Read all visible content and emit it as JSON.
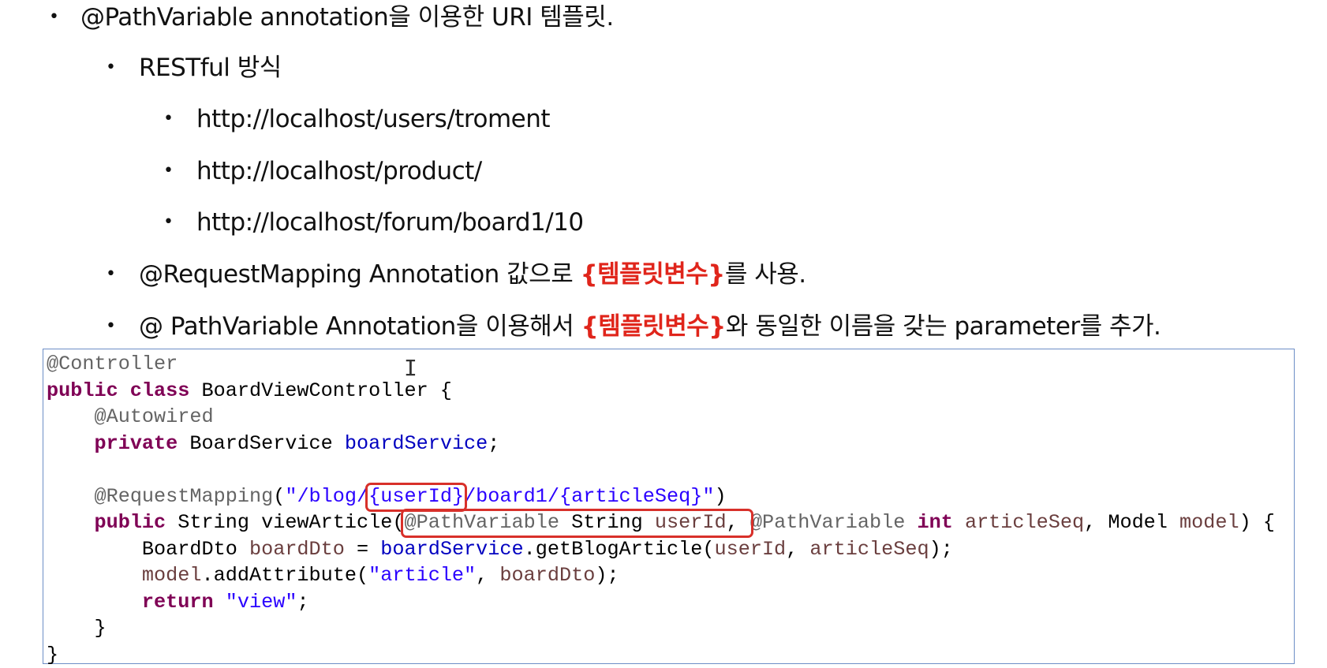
{
  "bullets": {
    "b1": "@PathVariable annotation을 이용한 URI 템플릿.",
    "b2": "RESTful 방식",
    "b3": "http://localhost/users/troment",
    "b4": "http://localhost/product/",
    "b5": "http://localhost/forum/board1/10",
    "b6_pre": "@RequestMapping Annotation 값으로 ",
    "b6_red": "{템플릿변수}",
    "b6_post": "를 사용.",
    "b7_pre": "@ PathVariable Annotation을 이용해서 ",
    "b7_red": "{템플릿변수}",
    "b7_post": "와 동일한 이름을 갖는 parameter를 추가."
  },
  "code": {
    "l1": "@Controller",
    "l2_kw": "public class",
    "l2": " BoardViewController {",
    "l3": "@Autowired",
    "l4_kw": "private",
    "l4_type": " BoardService ",
    "l4_field": "boardService",
    "l4_end": ";",
    "l6_an": "@RequestMapping",
    "l6_open": "(",
    "l6_s1": "\"/blog/",
    "l6_s2": "{userId}",
    "l6_s3": "/board1/{articleSeq}\"",
    "l6_close": ")",
    "l7_kw": "public",
    "l7_a": " String viewArticle(",
    "l7_an": "@PathVariable",
    "l7_b": " String ",
    "l7_v": "userId",
    "l7_c": ", ",
    "l7_an2": "@PathVariable",
    "l7_kw2": "int",
    "l7_v2": "articleSeq",
    "l7_d": ", Model ",
    "l7_v3": "model",
    "l7_e": ") {",
    "l8_a": "BoardDto ",
    "l8_v": "boardDto",
    "l8_b": " = ",
    "l8_f": "boardService",
    "l8_c": ".getBlogArticle(",
    "l8_v2": "userId",
    "l8_d": ", ",
    "l8_v3": "articleSeq",
    "l8_e": ");",
    "l9_v": "model",
    "l9_a": ".addAttribute(",
    "l9_s": "\"article\"",
    "l9_b": ", ",
    "l9_v2": "boardDto",
    "l9_c": ");",
    "l10_kw": "return",
    "l10_s": "\"view\"",
    "l10_e": ";",
    "l11": "}",
    "l12": "}"
  },
  "colors": {
    "highlight": "#e0251b",
    "box_border": "#6d8ec6"
  }
}
